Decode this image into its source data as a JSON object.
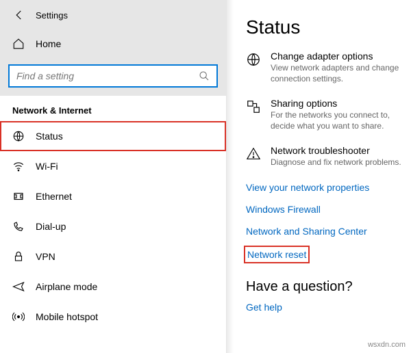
{
  "app": {
    "title": "Settings"
  },
  "home": {
    "label": "Home"
  },
  "search": {
    "placeholder": "Find a setting"
  },
  "section": {
    "title": "Network & Internet"
  },
  "nav": [
    {
      "label": "Status",
      "selected": true
    },
    {
      "label": "Wi-Fi"
    },
    {
      "label": "Ethernet"
    },
    {
      "label": "Dial-up"
    },
    {
      "label": "VPN"
    },
    {
      "label": "Airplane mode"
    },
    {
      "label": "Mobile hotspot"
    }
  ],
  "page": {
    "title": "Status",
    "options": [
      {
        "title": "Change adapter options",
        "desc": "View network adapters and change connection settings."
      },
      {
        "title": "Sharing options",
        "desc": "For the networks you connect to, decide what you want to share."
      },
      {
        "title": "Network troubleshooter",
        "desc": "Diagnose and fix network problems."
      }
    ],
    "links": [
      "View your network properties",
      "Windows Firewall",
      "Network and Sharing Center",
      "Network reset"
    ],
    "question": "Have a question?",
    "help": "Get help"
  },
  "watermark": "wsxdn.com"
}
